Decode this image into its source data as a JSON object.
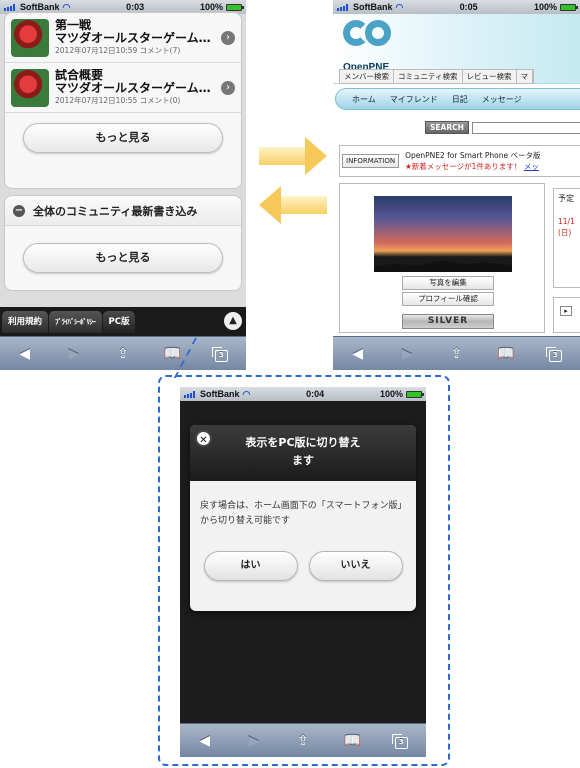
{
  "status": {
    "carrier": "SoftBank",
    "battery": "100%",
    "time_p1": "0:03",
    "time_p2": "0:05",
    "time_p3": "0:04"
  },
  "phone1": {
    "items": [
      {
        "title": "第一戦",
        "subtitle": "マツダオールスターゲーム…",
        "meta": "2012年07月12日10:59 コメント(7)"
      },
      {
        "title": "試合概要",
        "subtitle": "マツダオールスターゲーム…",
        "meta": "2012年07月12日10:55 コメント(0)"
      }
    ],
    "more_label": "もっと見る",
    "section_title": "全体のコミュニティ最新書き込み",
    "more_label2": "もっと見る",
    "footer_tabs": [
      "利用規約",
      "ﾌﾟﾗｲﾊﾞｼｰﾎﾟﾘｼｰ",
      "PC版"
    ]
  },
  "phone2": {
    "brand": "OpenPNE",
    "top_links": [
      "メンバー検索",
      "コミュニティ検索",
      "レビュー検索",
      "マ"
    ],
    "nav": [
      "ホーム",
      "マイフレンド",
      "日記",
      "メッセージ"
    ],
    "search_label": "SEARCH",
    "info_label": "INFORMATION",
    "info_line1": "OpenPNE2 for Smart Phone ベータ版",
    "info_line2": "★新着メッセージが1件あります！",
    "info_link": "メッ",
    "btn_photo": "写真を編集",
    "btn_profile": "プロフィール確認",
    "rank": "SILVER",
    "side_title": "予定",
    "side_date": "11/1",
    "side_day": "(日)"
  },
  "phone3": {
    "dialog_title_line1": "表示をPC版に切り替え",
    "dialog_title_line2": "ます",
    "dialog_body": "戻す場合は、ホーム画面下の「スマートフォン版」から切り替え可能です",
    "yes": "はい",
    "no": "いいえ"
  },
  "safari": {
    "pages_count": "3"
  },
  "colors": {
    "accent_blue": "#2f6ad2",
    "arrow_yellow": "#f6c85a",
    "openpne_blue": "#4aa3c7"
  }
}
